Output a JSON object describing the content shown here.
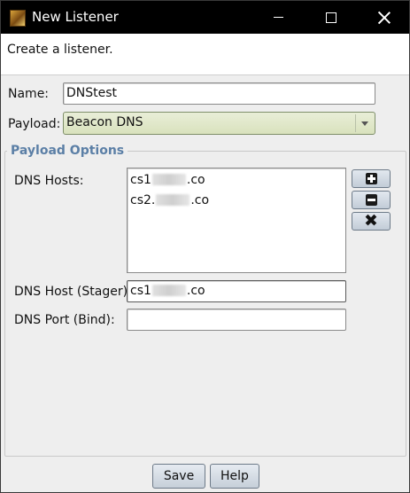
{
  "window": {
    "title": "New Listener"
  },
  "banner": {
    "text": "Create a listener."
  },
  "form": {
    "name_label": "Name:",
    "name_value": "DNStest",
    "payload_label": "Payload:",
    "payload_value": "Beacon DNS"
  },
  "payload_options": {
    "title": "Payload Options",
    "dns_hosts_label": "DNS Hosts:",
    "dns_hosts": [
      {
        "prefix": "cs1",
        "suffix": ".co"
      },
      {
        "prefix": "cs2.",
        "suffix": ".co"
      }
    ],
    "dns_host_stager_label": "DNS Host (Stager):",
    "dns_host_stager_prefix": "cs1",
    "dns_host_stager_suffix": ".co",
    "dns_port_label": "DNS Port (Bind):",
    "dns_port_value": ""
  },
  "buttons": {
    "save": "Save",
    "help": "Help"
  },
  "colors": {
    "title_bar": "#000000",
    "group_title": "#5b7fa6",
    "combo_bg": "#dfe6c6"
  },
  "icons": [
    "app-icon",
    "minimize-icon",
    "maximize-icon",
    "close-icon",
    "add-icon",
    "remove-icon",
    "clear-icon",
    "dropdown-arrow-icon"
  ]
}
